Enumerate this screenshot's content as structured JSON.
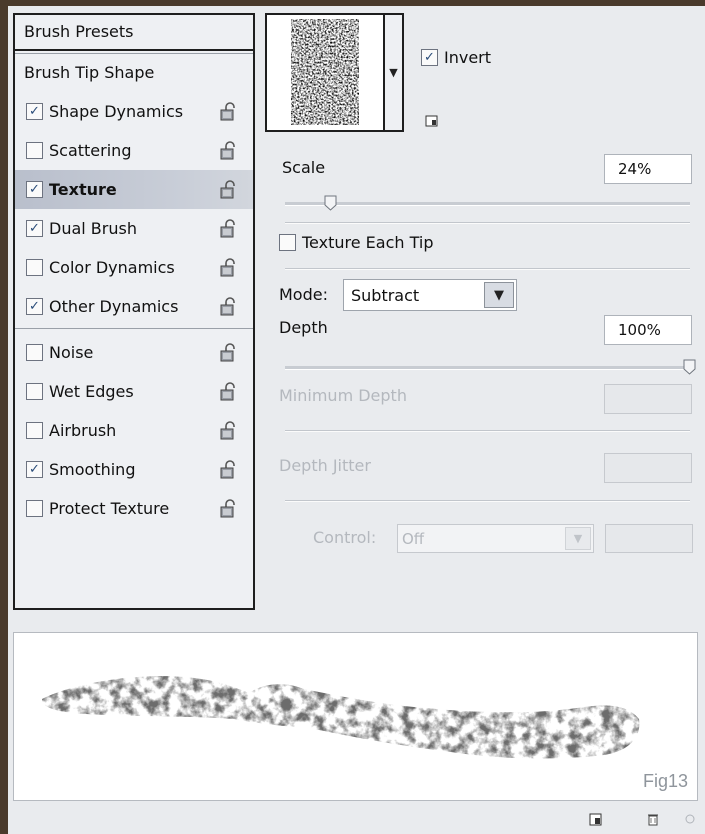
{
  "left_panel": {
    "header": "Brush Presets",
    "tip_shape": "Brush Tip Shape",
    "items": [
      {
        "label": "Shape Dynamics",
        "checked": true
      },
      {
        "label": "Scattering",
        "checked": false
      },
      {
        "label": "Texture",
        "checked": true,
        "selected": true
      },
      {
        "label": "Dual Brush",
        "checked": true
      },
      {
        "label": "Color Dynamics",
        "checked": false
      },
      {
        "label": "Other Dynamics",
        "checked": true
      },
      {
        "label": "Noise",
        "checked": false
      },
      {
        "label": "Wet Edges",
        "checked": false
      },
      {
        "label": "Airbrush",
        "checked": false
      },
      {
        "label": "Smoothing",
        "checked": true
      },
      {
        "label": "Protect Texture",
        "checked": false
      }
    ]
  },
  "texture": {
    "invert_label": "Invert",
    "invert_checked": true,
    "scale_label": "Scale",
    "scale_value": "24%",
    "scale_slider_fraction": 0.24,
    "texture_each_tip_label": "Texture Each Tip",
    "texture_each_tip_checked": false,
    "mode_label": "Mode:",
    "mode_value": "Subtract",
    "depth_label": "Depth",
    "depth_value": "100%",
    "depth_slider_fraction": 1.0,
    "min_depth_label": "Minimum Depth",
    "depth_jitter_label": "Depth Jitter",
    "control_label": "Control:",
    "control_value": "Off"
  },
  "preview": {
    "caption": "Fig13"
  },
  "icons": {
    "lock": "lock-icon",
    "new_preset": "new-preset-icon",
    "delete": "trash-icon"
  }
}
